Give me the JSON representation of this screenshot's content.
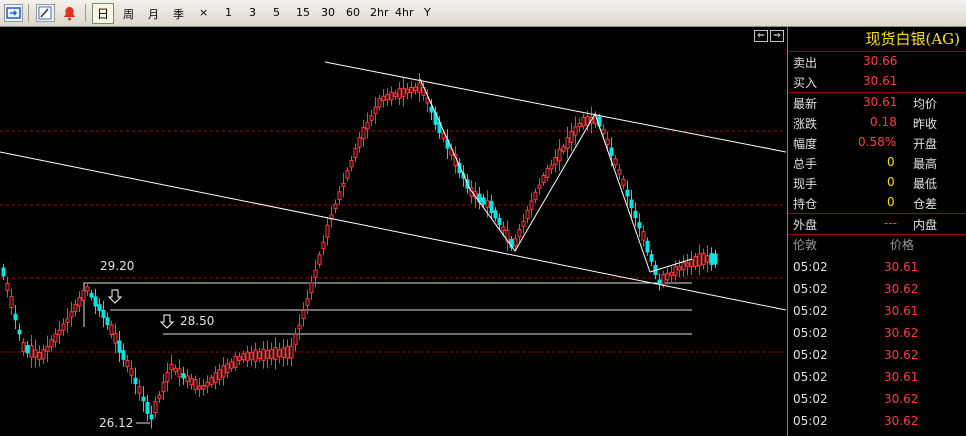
{
  "toolbar": {
    "periods": [
      "日",
      "周",
      "月",
      "季",
      "×",
      "1",
      "3",
      "5",
      "15",
      "30",
      "60",
      "2hr",
      "4hr",
      "Y"
    ],
    "active_period": "日"
  },
  "chart": {
    "annotations": {
      "label_high": "29.20",
      "label_mid": "28.50",
      "label_low": "26.12"
    },
    "colors": {
      "up": "#ff3c3c",
      "down": "#00e4e4",
      "trendline": "#ffffff",
      "grid": "#a00000"
    }
  },
  "chart_data": {
    "type": "candlestick",
    "annotations": [
      "29.20",
      "28.50",
      "26.12"
    ]
  },
  "panel": {
    "title": "现货白银(AG)",
    "quote": {
      "sell_label": "卖出",
      "sell_value": "30.66",
      "buy_label": "买入",
      "buy_value": "30.61"
    },
    "stats": [
      {
        "label": "最新",
        "value": "30.61",
        "right_label": "均价"
      },
      {
        "label": "涨跌",
        "value": "0.18",
        "right_label": "昨收"
      },
      {
        "label": "幅度",
        "value": "0.58%",
        "right_label": "开盘"
      },
      {
        "label": "总手",
        "value": "0",
        "right_label": "最高"
      },
      {
        "label": "现手",
        "value": "0",
        "right_label": "最低"
      },
      {
        "label": "持仓",
        "value": "0",
        "right_label": "仓差"
      }
    ],
    "outer_label": "外盘",
    "outer_value": "---",
    "inner_label": "内盘",
    "ticks_header_left": "伦敦",
    "ticks_header_right": "价格",
    "ticks": [
      {
        "time": "05:02",
        "price": "30.61"
      },
      {
        "time": "05:02",
        "price": "30.62"
      },
      {
        "time": "05:02",
        "price": "30.61"
      },
      {
        "time": "05:02",
        "price": "30.62"
      },
      {
        "time": "05:02",
        "price": "30.62"
      },
      {
        "time": "05:02",
        "price": "30.61"
      },
      {
        "time": "05:02",
        "price": "30.62"
      },
      {
        "time": "05:02",
        "price": "30.62"
      }
    ]
  }
}
